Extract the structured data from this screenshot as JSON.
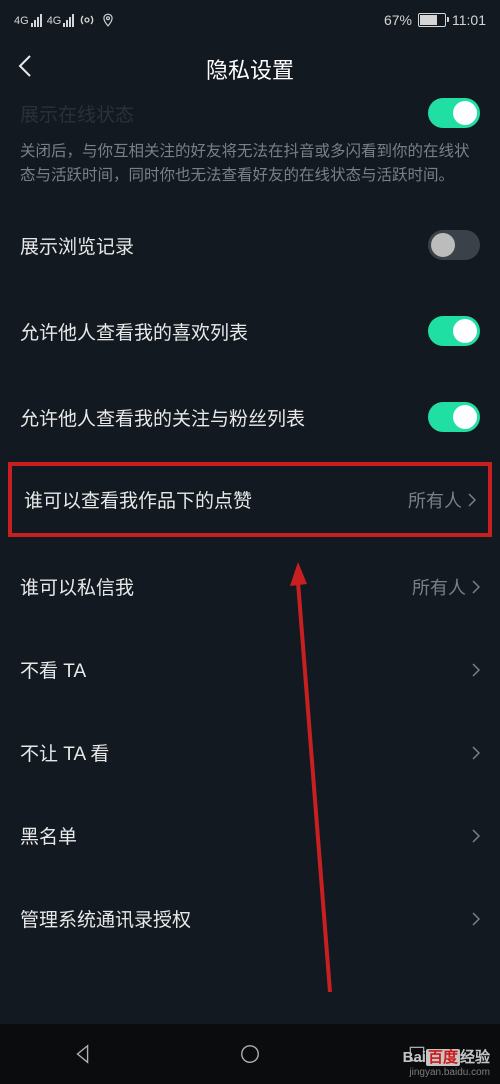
{
  "status": {
    "signal1_label": "4G",
    "signal2_label": "4G",
    "battery_pct": "67%",
    "time": "11:01"
  },
  "header": {
    "title": "隐私设置"
  },
  "partial": {
    "title": "展示在线状态",
    "description": "关闭后，与你互相关注的好友将无法在抖音或多闪看到你的在线状态与活跃时间，同时你也无法查看好友的在线状态与活跃时间。"
  },
  "rows": {
    "browse_history": {
      "label": "展示浏览记录"
    },
    "show_likes": {
      "label": "允许他人查看我的喜欢列表"
    },
    "show_follow": {
      "label": "允许他人查看我的关注与粉丝列表"
    },
    "who_likes": {
      "label": "谁可以查看我作品下的点赞",
      "value": "所有人"
    },
    "who_dm": {
      "label": "谁可以私信我",
      "value": "所有人"
    },
    "block_view": {
      "label": "不看 TA"
    },
    "hide_from": {
      "label": "不让 TA 看"
    },
    "blacklist": {
      "label": "黑名单"
    },
    "contacts": {
      "label": "管理系统通讯录授权"
    }
  },
  "watermark": {
    "brand_a": "Bai",
    "brand_b": "百度",
    "brand_c": "经验",
    "url": "jingyan.baidu.com"
  }
}
